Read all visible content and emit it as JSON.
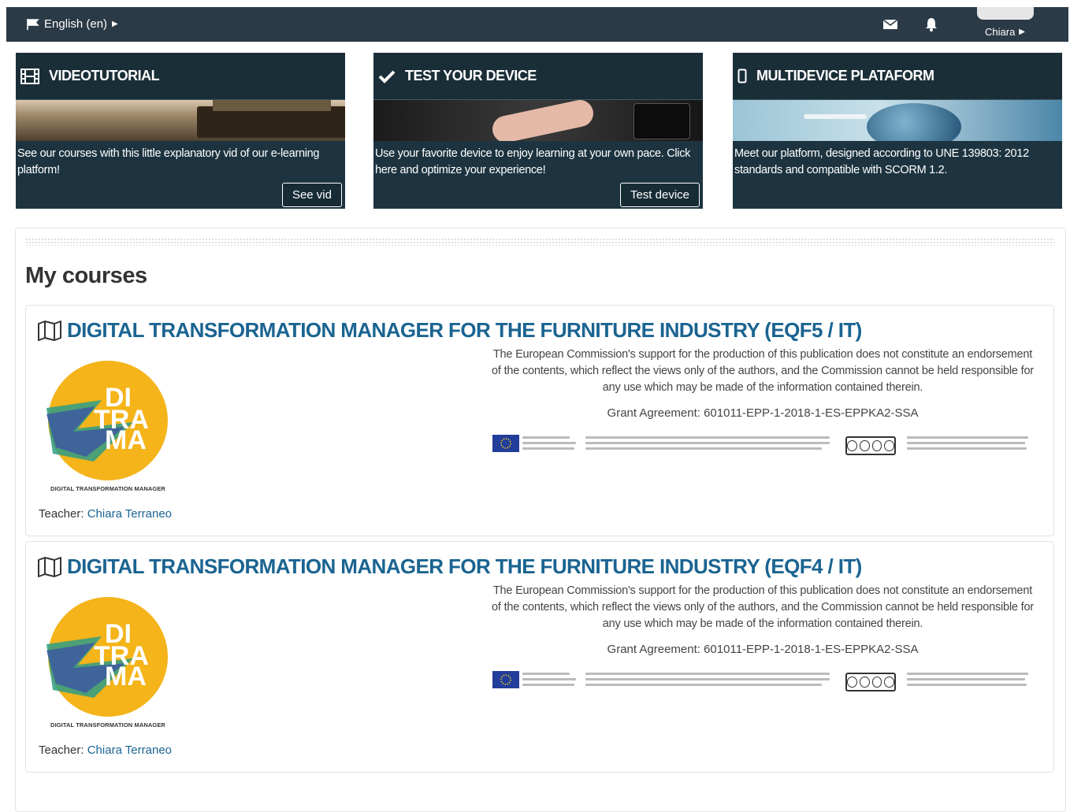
{
  "topbar": {
    "language": "English (en)",
    "user_name": "Chiara"
  },
  "cards": [
    {
      "title": "VIDEOTUTORIAL",
      "icon": "film-icon",
      "description": "See our courses with this little explanatory vid of our e-learning platform!",
      "button": "See vid"
    },
    {
      "title": "TEST YOUR DEVICE",
      "icon": "check-icon",
      "description": "Use your favorite device to enjoy learning at your own pace. Click here and optimize your experience!",
      "button": "Test device"
    },
    {
      "title": "MULTIDEVICE PLATAFORM",
      "icon": "mobile-icon",
      "description": "Meet our platform, designed according to UNE 139803: 2012 standards and compatible with SCORM 1.2."
    }
  ],
  "my_courses": {
    "heading": "My courses",
    "courses": [
      {
        "title": "DIGITAL TRANSFORMATION MANAGER FOR THE FURNITURE INDUSTRY (EQF5 / IT)",
        "logo_text": [
          "DI",
          "TRA",
          "MA"
        ],
        "logo_caption": "DIGITAL TRANSFORMATION MANAGER",
        "teacher_label": "Teacher:",
        "teacher_name": "Chiara Terraneo",
        "disclaimer": "The European Commission's support for the production of this publication does not constitute an endorsement of the contents, which reflect the views only of the authors, and the Commission cannot be held responsible for any use which may be made of the information contained therein.",
        "grant": "Grant Agreement: 601011-EPP-1-2018-1-ES-EPPKA2-SSA"
      },
      {
        "title": "DIGITAL TRANSFORMATION MANAGER FOR THE FURNITURE INDUSTRY (EQF4 / IT)",
        "logo_text": [
          "DI",
          "TRA",
          "MA"
        ],
        "logo_caption": "DIGITAL TRANSFORMATION MANAGER",
        "teacher_label": "Teacher:",
        "teacher_name": "Chiara Terraneo",
        "disclaimer": "The European Commission's support for the production of this publication does not constitute an endorsement of the contents, which reflect the views only of the authors, and the Commission cannot be held responsible for any use which may be made of the information contained therein.",
        "grant": "Grant Agreement: 601011-EPP-1-2018-1-ES-EPPKA2-SSA"
      }
    ]
  },
  "colors": {
    "topbar": "#2b3a47",
    "card_bg": "#1d3440",
    "link": "#1a6491",
    "logo_yellow": "#f4b41a"
  }
}
